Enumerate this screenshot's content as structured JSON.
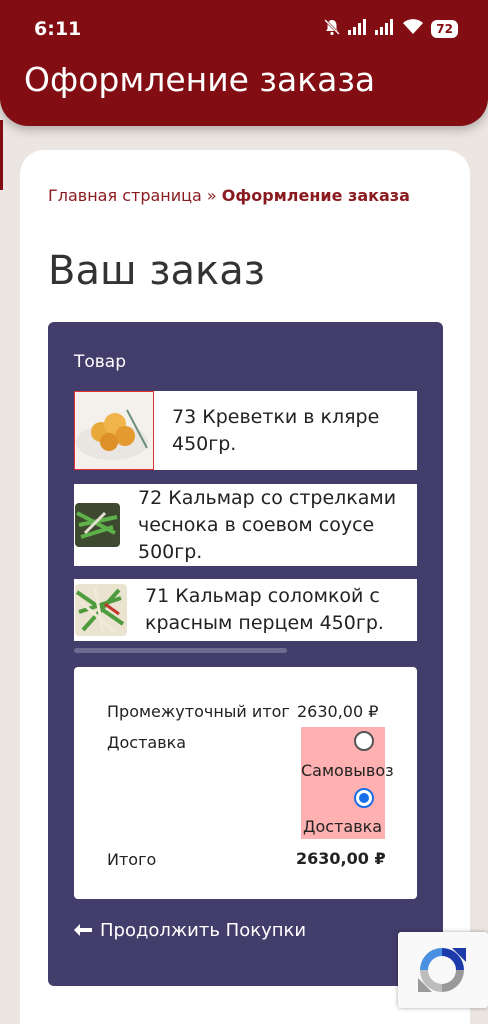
{
  "status_bar": {
    "time": "6:11",
    "battery": "72",
    "icons": [
      "bell-off-icon",
      "signal-icon",
      "signal-icon",
      "wifi-icon",
      "battery-icon"
    ]
  },
  "header": {
    "title": "Оформление заказа"
  },
  "breadcrumb": {
    "home": "Главная страница",
    "separator": " » ",
    "current": "Оформление заказа"
  },
  "page": {
    "title": "Ваш заказ"
  },
  "order": {
    "column_label": "Товар",
    "products": [
      {
        "name": "73 Креветки в кляре 450гр."
      },
      {
        "name": "72 Кальмар со стрелками чеснока в соевом соусе 500гр."
      },
      {
        "name": "71 Кальмар соломкой с красным перцем 450гр."
      }
    ],
    "subtotal_label": "Промежуточный итог",
    "subtotal_value": "2630,00 ₽",
    "shipping_label": "Доставка",
    "shipping_options": [
      {
        "label": "Самовывоз",
        "selected": false
      },
      {
        "label": "Доставка",
        "selected": true
      }
    ],
    "total_label": "Итого",
    "total_value": "2630,00 ₽",
    "continue_label": "Продолжить Покупки"
  },
  "colors": {
    "brand": "#820d12",
    "panel": "#433d6b",
    "selected_radio": "#1a6fe8"
  }
}
